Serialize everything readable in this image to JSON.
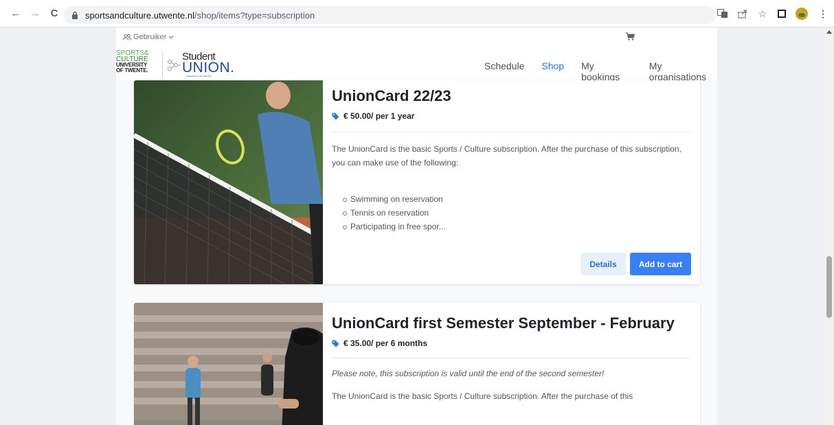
{
  "browser": {
    "url_domain": "sportsandculture.utwente.nl",
    "url_path": "/shop/items?type=subscription",
    "back_icon": "←",
    "forward_icon": "→",
    "reload_icon": "C",
    "star_icon": "☆",
    "menu_icon": "⋮"
  },
  "header": {
    "user_label": "Gebruiker",
    "logo_sports": "SPORTS&",
    "logo_culture": "CULTURE",
    "logo_university": "UNIVERSITY",
    "logo_twente": "OF TWENTE.",
    "logo_student": "Student",
    "logo_union": "UNION.",
    "logo_union_sub": "UNIVERSITY OF TWENTE",
    "nav": {
      "schedule": "Schedule",
      "shop": "Shop",
      "bookings": "My bookings",
      "organisations": "My organisations"
    }
  },
  "products": [
    {
      "title": "UnionCard 22/23",
      "price": "€ 50.00/ per 1 year",
      "description": "The UnionCard is the basic Sports / Culture subscription. After the purchase of this subscription, you can make use of the following:",
      "features": [
        "Swimming on reservation",
        "Tennis on reservation",
        "Participating in free spor..."
      ],
      "details_label": "Details",
      "cart_label": "Add to cart"
    },
    {
      "title": "UnionCard first Semester September - February",
      "price": "€ 35.00/ per 6 months",
      "note": "Please note, this subscription is valid until the end of the second semester!",
      "description": "The UnionCard is the basic Sports / Culture subscription. After the purchase of this"
    }
  ],
  "colors": {
    "accent": "#3a7ff5",
    "nav_active": "#2f76d2",
    "tag": "#2f76d2"
  }
}
